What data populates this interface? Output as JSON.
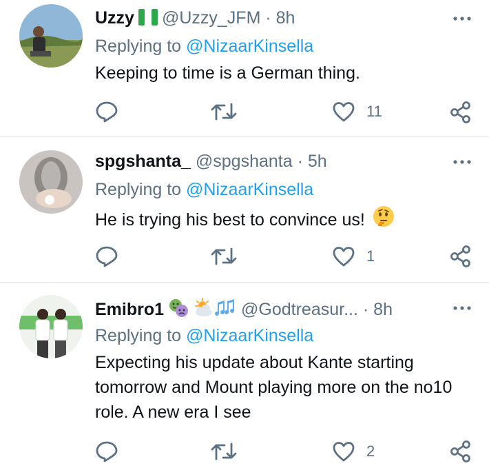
{
  "tweets": [
    {
      "name": "Uzzy",
      "handle": "@Uzzy_JFM",
      "time": "8h",
      "replying_prefix": "Replying to",
      "replying_to": "@NizaarKinsella",
      "text": "Keeping to time is a German thing.",
      "likes": "11"
    },
    {
      "name": "spgshanta_",
      "handle": "@spgshanta",
      "time": "5h",
      "replying_prefix": "Replying to",
      "replying_to": "@NizaarKinsella",
      "text": "He is trying his best to convince us!",
      "likes": "1"
    },
    {
      "name": "Emibro1",
      "handle": "@Godtreasur...",
      "time": "8h",
      "replying_prefix": "Replying to",
      "replying_to": "@NizaarKinsella",
      "text": "Expecting his update about Kante starting tomorrow and Mount playing more on the no10 role. A new era I see",
      "likes": "2"
    }
  ],
  "separator": "·",
  "icons": {
    "reply": "reply-icon",
    "retweet": "retweet-icon",
    "like": "heart-icon",
    "share": "share-icon",
    "more": "more-options-icon",
    "flag": "nigeria-flag-icon",
    "thinking": "thinking-face-emoji",
    "name_emojis": [
      "performing-arts-emoji",
      "sun-behind-cloud-emoji",
      "musical-notes-emoji"
    ]
  },
  "colors": {
    "text": "#0f1419",
    "secondary": "#5b7083",
    "link": "#1da1f2",
    "divider": "#e1e6ea"
  }
}
